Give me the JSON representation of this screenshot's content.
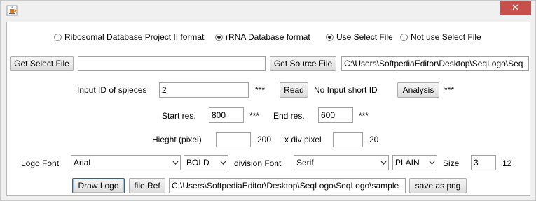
{
  "window": {
    "close_glyph": "✕",
    "icon": "java-cup-icon"
  },
  "format_options": [
    {
      "label": "Ribosomal Database Project II format",
      "selected": false
    },
    {
      "label": "rRNA Database format",
      "selected": true
    }
  ],
  "select_file_options": [
    {
      "label": "Use Select File",
      "selected": true
    },
    {
      "label": "Not use Select File",
      "selected": false
    }
  ],
  "files": {
    "get_select_label": "Get Select File",
    "select_file_value": "",
    "get_source_label": "Get Source File",
    "source_file_value": "C:\\Users\\SoftpediaEditor\\Desktop\\SeqLogo\\Seq"
  },
  "species": {
    "label": "Input ID of spieces",
    "value": "2",
    "stars": "***",
    "read_label": "Read",
    "status": "No Input short ID",
    "analysis_label": "Analysis",
    "analysis_stars": "***"
  },
  "residues": {
    "start_label": "Start res.",
    "start_value": "800",
    "start_stars": "***",
    "end_label": "End res.",
    "end_value": "600",
    "end_stars": "***"
  },
  "dimensions": {
    "height_label": "Hieght (pixel)",
    "height_value": "",
    "height_default": "200",
    "xdiv_label": "x div pixel",
    "xdiv_value": "",
    "xdiv_default": "20"
  },
  "fonts": {
    "logo_font_label": "Logo Font",
    "logo_font_value": "Arial",
    "logo_style_value": "BOLD",
    "division_font_label": "division Font",
    "division_font_value": "Serif",
    "division_style_value": "PLAIN",
    "size_label": "Size",
    "size_value": "3",
    "size_default": "12"
  },
  "actions": {
    "draw_label": "Draw Logo",
    "file_ref_label": "file Ref",
    "output_path": "C:\\Users\\SoftpediaEditor\\Desktop\\SeqLogo\\SeqLogo\\sample",
    "save_label": "save as png"
  }
}
